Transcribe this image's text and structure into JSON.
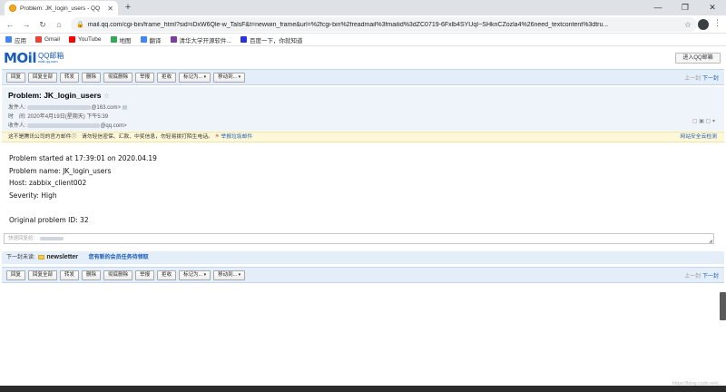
{
  "browser": {
    "tab_title": "Problem: JK_login_users - QQ",
    "url": "mail.qq.com/cgi-bin/frame_html?sid=iDxW6Qle-w_TalsF&t=newwin_frame&url=%2fcgi-bin%2freadmail%3fmailid%3dZC0719-6Fxlb4SYUqI~SHknCZozla4%26need_textcontent%3dtru...",
    "bookmarks": [
      {
        "label": "应用",
        "color": "#4285f4"
      },
      {
        "label": "Gmail",
        "color": "#ea4335"
      },
      {
        "label": "YouTube",
        "color": "#ff0000"
      },
      {
        "label": "地图",
        "color": "#34a853"
      },
      {
        "label": "翻译",
        "color": "#4285f4"
      },
      {
        "label": "清华大学开源软件...",
        "color": "#7b3fa0"
      },
      {
        "label": "百度一下，你就知道",
        "color": "#2932e1"
      }
    ]
  },
  "mail_logo": {
    "text": "MOil",
    "qq": "QQ邮箱",
    "sub": "mail.qq.com"
  },
  "enter_button": "进入QQ邮箱",
  "toolbar": {
    "buttons": [
      "回复",
      "回复全部",
      "转发",
      "删除",
      "彻底删除",
      "举报",
      "拒收"
    ],
    "dropdowns": [
      "标记为...",
      "移动到..."
    ],
    "prev": "上一封",
    "next": "下一封"
  },
  "mail": {
    "subject": "Problem: JK_login_users",
    "sender_label": "发件人:",
    "sender_suffix": "@163.com>",
    "time_label": "时　间:",
    "time_value": "2020年4月19日(星期天) 下午5:39",
    "receiver_label": "收件人:",
    "receiver_suffix": "@qq.com>"
  },
  "notice": {
    "text": "这不是腾讯公司的官方邮件",
    "warning": "请勿轻信密保、汇款、中奖信息，勿轻易拨打陌生电话。",
    "report": "举报垃圾邮件",
    "right": "网站安全云检测"
  },
  "body_lines": [
    "Problem started at 17:39:01 on 2020.04.19",
    "Problem name: JK_login_users",
    "Host: zabbix_client002",
    "Severity: High",
    "",
    "Original problem ID: 32"
  ],
  "quick_reply": {
    "placeholder": "快速回复给："
  },
  "next_mail": {
    "label": "下一封未读:",
    "title": "newsletter",
    "promo": "您有新的会员任务待领取"
  },
  "watermark": "https://blog.csdn.net/..."
}
